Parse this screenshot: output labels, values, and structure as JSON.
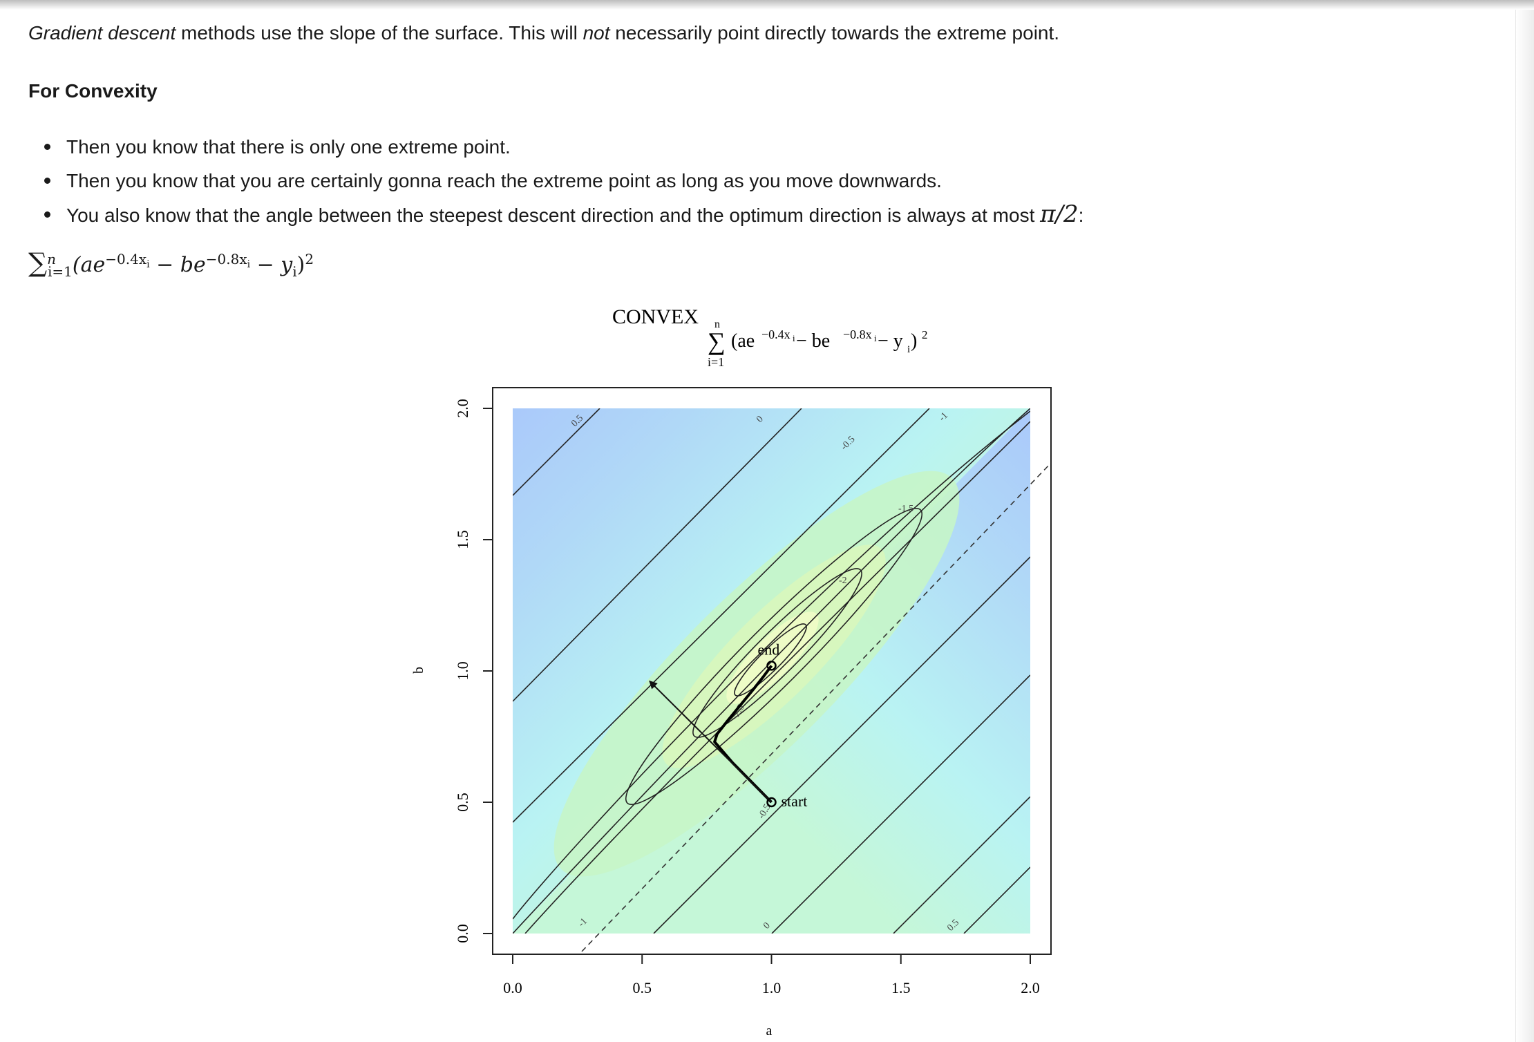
{
  "intro": {
    "part1_em": "Gradient descent",
    "part2": " methods use the slope of the surface. This will ",
    "part3_em": "not",
    "part4": " necessarily point directly towards the extreme point."
  },
  "heading": "For Convexity",
  "bullets": [
    "Then you know that there is only one extreme point.",
    "Then you know that you are certainly gonna reach the extreme point as long as you move downwards.",
    "You also know that the angle between the steepest descent direction and the optimum direction is always at most "
  ],
  "bullet3_math": "π/2",
  "bullet3_tail": ":",
  "formula": {
    "sum": "∑",
    "sup_n": "n",
    "sub_i": "i=1",
    "open": "(ae",
    "exp1": "−0.4x",
    "exp1_sub": "i",
    "minus_b": " − be",
    "exp2": "−0.8x",
    "exp2_sub": "i",
    "minus_y": " − y",
    "y_sub": "i",
    "close": ")",
    "sq": "2"
  },
  "chart_data": {
    "type": "contour",
    "title": "CONVEX",
    "subtitle_formula": {
      "sum_top": "n",
      "sum": "∑",
      "sum_bottom": "i=1",
      "open": "(ae",
      "exp1": "−0.4x",
      "exp1_sub": "i",
      "mid": " − be",
      "exp2": "−0.8x",
      "exp2_sub": "i",
      "tail": " − y",
      "tail_sub": "i",
      "close": ")",
      "sq": "2"
    },
    "xlabel": "a",
    "ylabel": "b",
    "xlim": [
      0,
      2
    ],
    "ylim": [
      0,
      2
    ],
    "x_ticks": [
      "0.0",
      "0.5",
      "1.0",
      "1.5",
      "2.0"
    ],
    "y_ticks": [
      "0.0",
      "0.5",
      "1.0",
      "1.5",
      "2.0"
    ],
    "contour_labels": [
      "0.5",
      "0",
      "-0.5",
      "-1",
      "-1.5",
      "-2",
      "-2.5",
      "-0.5",
      "0",
      "-1",
      "0.5"
    ],
    "path_start": {
      "label": "start",
      "a": 1.0,
      "b": 0.5
    },
    "path_end": {
      "label": "end",
      "a": 1.0,
      "b": 1.02
    },
    "path_points": [
      [
        1.0,
        0.5
      ],
      [
        0.95,
        0.55
      ],
      [
        0.91,
        0.59
      ],
      [
        0.85,
        0.65
      ],
      [
        0.78,
        0.73
      ],
      [
        0.79,
        0.76
      ],
      [
        0.83,
        0.81
      ],
      [
        0.88,
        0.87
      ],
      [
        0.93,
        0.93
      ],
      [
        0.97,
        0.98
      ],
      [
        1.0,
        1.02
      ]
    ],
    "gradient_arrow": {
      "from": [
        1.0,
        0.5
      ],
      "to": [
        0.53,
        0.96
      ]
    },
    "optimum_direction": {
      "through": [
        0.92,
        0.59
      ],
      "slope": 1
    },
    "legend": "none",
    "grid": false
  }
}
